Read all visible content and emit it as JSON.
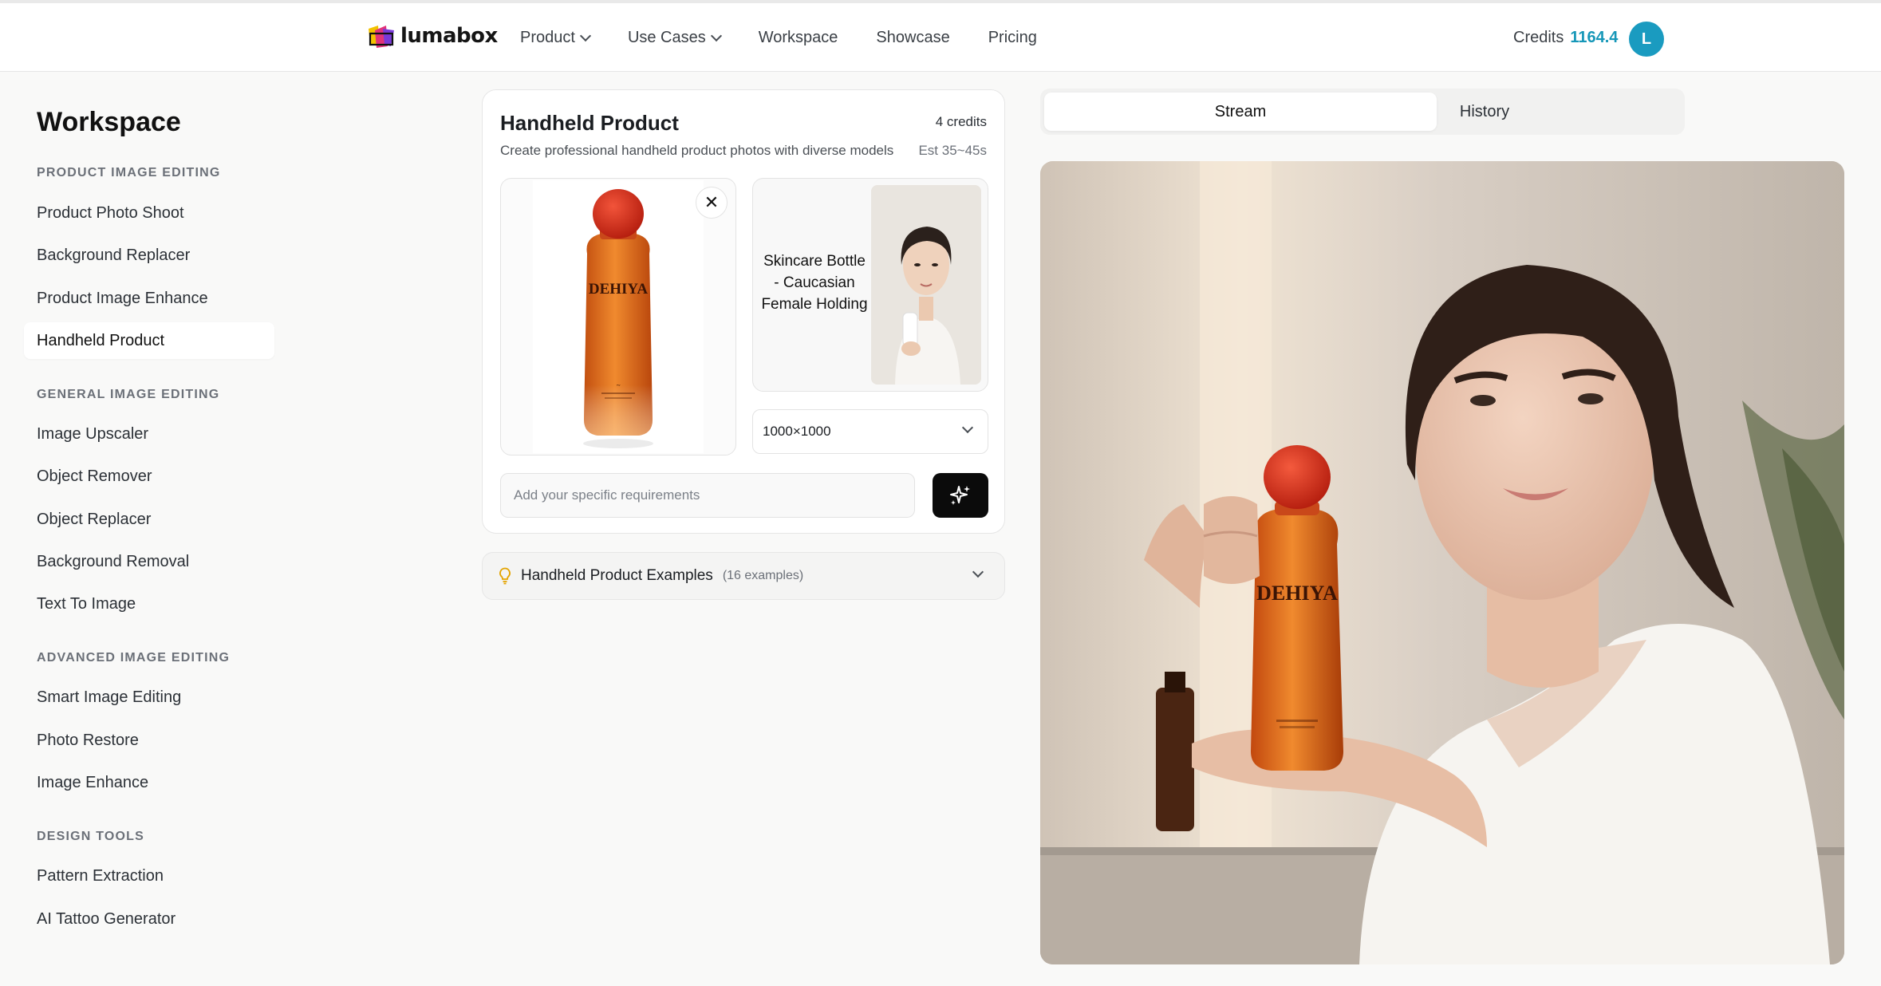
{
  "header": {
    "brand": "lumabox",
    "nav": [
      {
        "label": "Product",
        "dropdown": true
      },
      {
        "label": "Use Cases",
        "dropdown": true
      },
      {
        "label": "Workspace",
        "dropdown": false
      },
      {
        "label": "Showcase",
        "dropdown": false
      },
      {
        "label": "Pricing",
        "dropdown": false
      }
    ],
    "credits_label": "Credits",
    "credits_value": "1164.4",
    "avatar_initial": "L"
  },
  "sidebar": {
    "title": "Workspace",
    "sections": [
      {
        "label": "PRODUCT IMAGE EDITING",
        "items": [
          "Product Photo Shoot",
          "Background Replacer",
          "Product Image Enhance",
          "Handheld Product"
        ]
      },
      {
        "label": "GENERAL IMAGE EDITING",
        "items": [
          "Image Upscaler",
          "Object Remover",
          "Object Replacer",
          "Background Removal",
          "Text To Image"
        ]
      },
      {
        "label": "ADVANCED IMAGE EDITING",
        "items": [
          "Smart Image Editing",
          "Photo Restore",
          "Image Enhance"
        ]
      },
      {
        "label": "DESIGN TOOLS",
        "items": [
          "Pattern Extraction",
          "AI Tattoo Generator"
        ]
      }
    ],
    "active_item": "Handheld Product"
  },
  "tool": {
    "title": "Handheld Product",
    "credits": "4 credits",
    "description": "Create professional handheld product photos with diverse models",
    "estimate": "Est 35~45s",
    "product_brand_text": "DEHIYA",
    "model_label": "Skincare Bottle - Caucasian Female Holding",
    "size_value": "1000×1000",
    "requirements_placeholder": "Add your specific requirements",
    "examples_title": "Handheld Product Examples",
    "examples_count": "(16 examples)"
  },
  "result_panel": {
    "tabs": [
      "Stream",
      "History"
    ],
    "active_tab": "Stream",
    "image_brand_text": "DEHIYA"
  },
  "colors": {
    "accent": "#1a9bc0",
    "credits_value": "#1697b8",
    "bottle_orange": "#e1691b",
    "cap_red": "#d8301c"
  }
}
